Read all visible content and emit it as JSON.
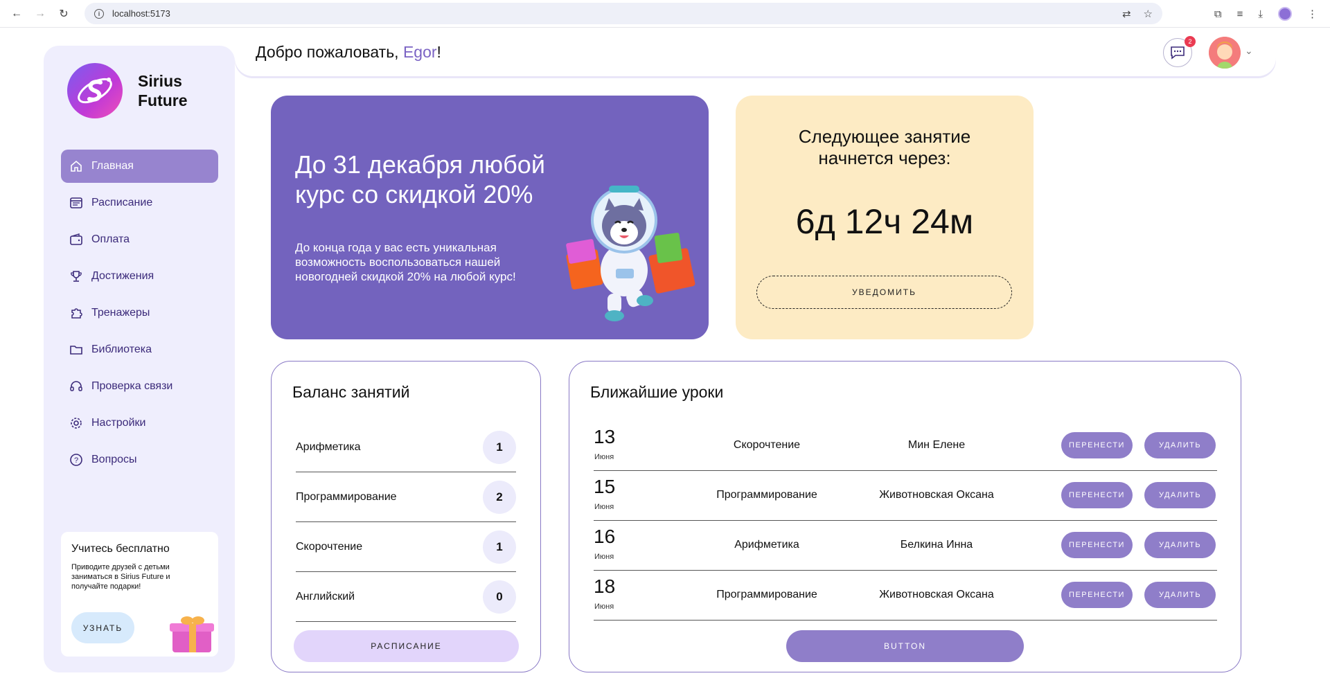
{
  "browser": {
    "url": "localhost:5173"
  },
  "app": {
    "logo_line1": "Sirius",
    "logo_line2": "Future"
  },
  "sidebar": {
    "items": [
      {
        "label": "Главная",
        "icon": "home-icon",
        "active": true
      },
      {
        "label": "Расписание",
        "icon": "calendar-icon",
        "active": false
      },
      {
        "label": "Оплата",
        "icon": "wallet-icon",
        "active": false
      },
      {
        "label": "Достижения",
        "icon": "trophy-icon",
        "active": false
      },
      {
        "label": "Тренажеры",
        "icon": "puzzle-icon",
        "active": false
      },
      {
        "label": "Библиотека",
        "icon": "folder-icon",
        "active": false
      },
      {
        "label": "Проверка связи",
        "icon": "headset-icon",
        "active": false
      },
      {
        "label": "Настройки",
        "icon": "gear-icon",
        "active": false
      },
      {
        "label": "Вопросы",
        "icon": "question-icon",
        "active": false
      }
    ],
    "promo": {
      "title": "Учитесь бесплатно",
      "text": "Приводите друзей с детьми заниматься в Sirius Future и получайте подарки!",
      "button": "УЗНАТЬ"
    }
  },
  "header": {
    "greeting": "Добро пожаловать, ",
    "user_name": "Egor",
    "greeting_end": "!",
    "chat_badge": "2"
  },
  "banner": {
    "title": "До 31 декабря любой курс со скидкой 20%",
    "text": "До конца года у вас есть уникальная возможность воспользоваться нашей новогодней скидкой 20% на любой курс!"
  },
  "countdown": {
    "title": "Следующее занятие начнется через:",
    "time": "6д 12ч 24м",
    "button": "УВЕДОМИТЬ"
  },
  "balance": {
    "title": "Баланс занятий",
    "rows": [
      {
        "subject": "Арифметика",
        "count": "1"
      },
      {
        "subject": "Программирование",
        "count": "2"
      },
      {
        "subject": "Скорочтение",
        "count": "1"
      },
      {
        "subject": "Английский",
        "count": "0"
      }
    ],
    "button": "РАСПИСАНИЕ"
  },
  "lessons": {
    "title": "Ближайшие уроки",
    "move_label": "ПЕРЕНЕСТИ",
    "delete_label": "УДАЛИТЬ",
    "rows": [
      {
        "day": "13",
        "month": "Июня",
        "subject": "Скорочтение",
        "teacher": "Мин Елене"
      },
      {
        "day": "15",
        "month": "Июня",
        "subject": "Программирование",
        "teacher": "Животновская Оксана"
      },
      {
        "day": "16",
        "month": "Июня",
        "subject": "Арифметика",
        "teacher": "Белкина Инна"
      },
      {
        "day": "18",
        "month": "Июня",
        "subject": "Программирование",
        "teacher": "Животновская Оксана"
      }
    ],
    "button": "BUTTON"
  }
}
